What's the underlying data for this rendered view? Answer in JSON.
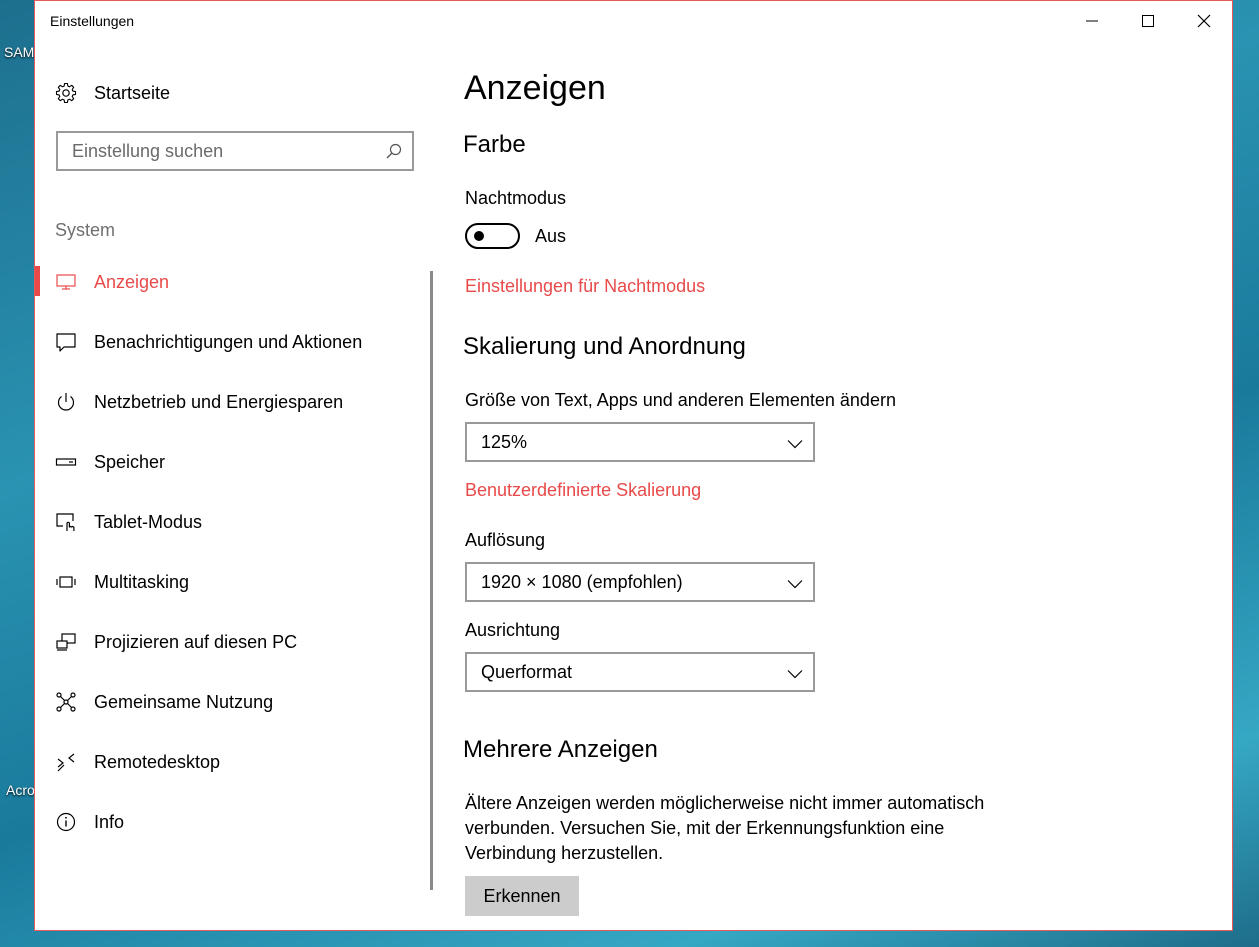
{
  "desktop": {
    "label_top": "SAM",
    "label_bottom": "Acro"
  },
  "window": {
    "title": "Einstellungen"
  },
  "sidebar": {
    "home_label": "Startseite",
    "search_placeholder": "Einstellung suchen",
    "group_label": "System",
    "items": [
      {
        "label": "Anzeigen",
        "icon": "monitor-icon",
        "active": true
      },
      {
        "label": "Benachrichtigungen und Aktionen",
        "icon": "notification-icon"
      },
      {
        "label": "Netzbetrieb und Energiesparen",
        "icon": "power-icon"
      },
      {
        "label": "Speicher",
        "icon": "storage-icon"
      },
      {
        "label": "Tablet-Modus",
        "icon": "tablet-mode-icon"
      },
      {
        "label": "Multitasking",
        "icon": "multitasking-icon"
      },
      {
        "label": "Projizieren auf diesen PC",
        "icon": "projection-icon"
      },
      {
        "label": "Gemeinsame Nutzung",
        "icon": "share-icon"
      },
      {
        "label": "Remotedesktop",
        "icon": "remote-desktop-icon"
      },
      {
        "label": "Info",
        "icon": "info-icon"
      }
    ]
  },
  "main": {
    "title": "Anzeigen",
    "color_section": {
      "heading": "Farbe",
      "night_mode_label": "Nachtmodus",
      "night_mode_state": "Aus",
      "night_mode_on": false,
      "night_mode_link": "Einstellungen für Nachtmodus"
    },
    "scale_section": {
      "heading": "Skalierung und Anordnung",
      "size_label": "Größe von Text, Apps und anderen Elementen ändern",
      "size_value": "125%",
      "custom_scaling_link": "Benutzerdefinierte Skalierung",
      "resolution_label": "Auflösung",
      "resolution_value": "1920 × 1080 (empfohlen)",
      "orientation_label": "Ausrichtung",
      "orientation_value": "Querformat"
    },
    "multi_section": {
      "heading": "Mehrere Anzeigen",
      "text": "Ältere Anzeigen werden möglicherweise nicht immer automatisch verbunden. Versuchen Sie, mit der Erkennungsfunktion eine Verbindung herzustellen.",
      "detect_button": "Erkennen"
    }
  },
  "colors": {
    "accent": "#e84a4a"
  }
}
